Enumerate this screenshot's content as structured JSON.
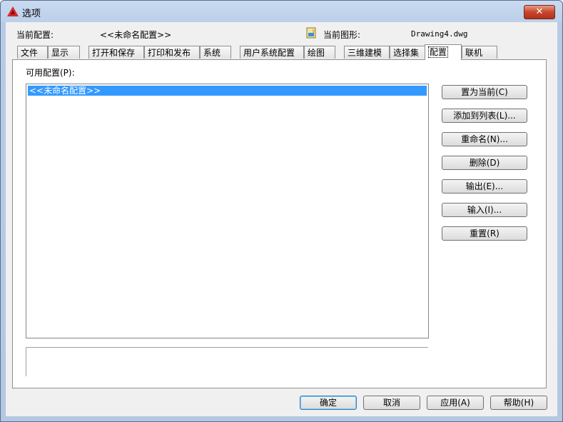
{
  "window": {
    "title": "选项",
    "close_label": "✕"
  },
  "header": {
    "current_profile_label": "当前配置:",
    "current_profile_value": "<<未命名配置>>",
    "current_drawing_label": "当前图形:",
    "current_drawing_value": "Drawing4.dwg"
  },
  "tabs": [
    {
      "label": "文件"
    },
    {
      "label": "显示"
    },
    {
      "label": "打开和保存"
    },
    {
      "label": "打印和发布"
    },
    {
      "label": "系统"
    },
    {
      "label": "用户系统配置"
    },
    {
      "label": "绘图"
    },
    {
      "label": "三维建模"
    },
    {
      "label": "选择集"
    },
    {
      "label": "配置",
      "active": true
    },
    {
      "label": "联机"
    }
  ],
  "profiles": {
    "label": "可用配置(P):",
    "items": [
      "<<未命名配置>>"
    ],
    "selected_index": 0
  },
  "side_buttons": {
    "set_current": "置为当前(C)",
    "add_to_list": "添加到列表(L)...",
    "rename": "重命名(N)...",
    "delete": "删除(D)",
    "export": "输出(E)...",
    "import": "输入(I)...",
    "reset": "重置(R)"
  },
  "footer": {
    "ok": "确定",
    "cancel": "取消",
    "apply": "应用(A)",
    "help": "帮助(H)"
  },
  "colors": {
    "selection": "#3399ff",
    "close_button": "#c7452c",
    "app_icon": "#d42a2a"
  }
}
